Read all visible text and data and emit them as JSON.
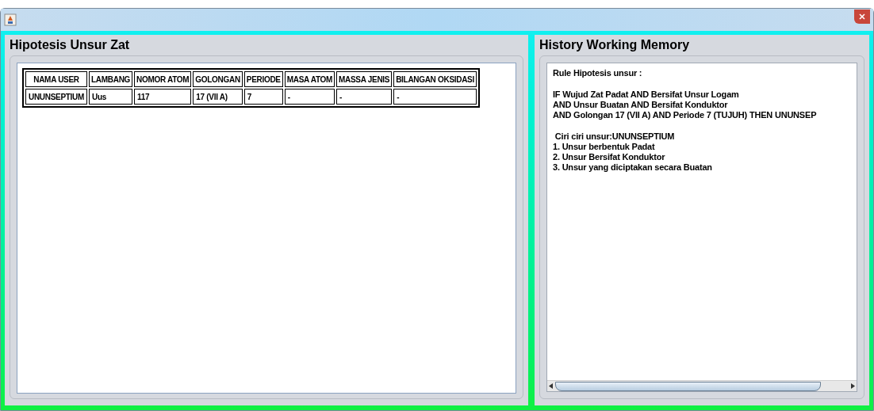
{
  "left_panel": {
    "title": "Hipotesis Unsur Zat",
    "table": {
      "columns": [
        "NAMA USER",
        "LAMBANG",
        "NOMOR ATOM",
        "GOLONGAN",
        "PERIODE",
        "MASA ATOM",
        "MASSA JENIS",
        "BILANGAN OKSIDASI"
      ],
      "rows": [
        [
          "UNUNSEPTIUM",
          "Uus",
          "117",
          "17 (VII A)",
          "7",
          "-",
          "-",
          "-"
        ]
      ]
    }
  },
  "right_panel": {
    "title": "History Working Memory",
    "text_blocks": [
      [
        "Rule Hipotesis unsur :"
      ],
      [
        "IF Wujud Zat Padat AND Bersifat Unsur Logam",
        "AND Unsur Buatan AND Bersifat Konduktor",
        "AND Golongan 17 (VII A) AND Periode 7 (TUJUH) THEN UNUNSEP"
      ],
      [
        " Ciri ciri unsur:UNUNSEPTIUM",
        "1. Unsur berbentuk Padat",
        "2. Unsur Bersifat Konduktor",
        "3. Unsur yang diciptakan secara Buatan"
      ]
    ]
  }
}
